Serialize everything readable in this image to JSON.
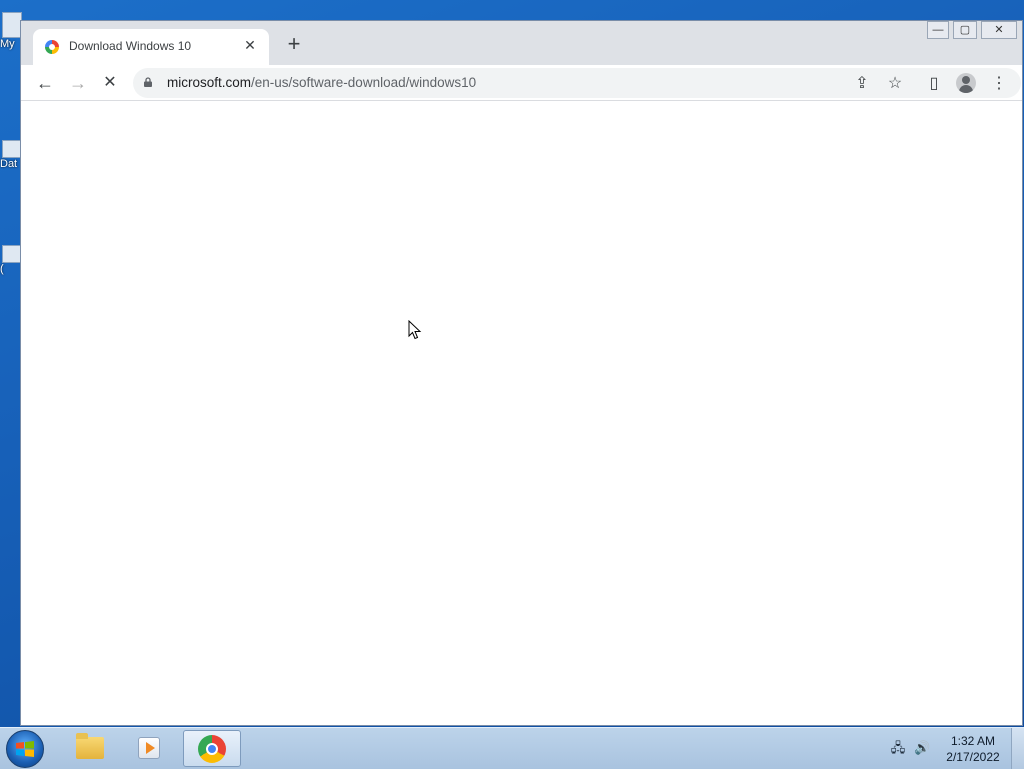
{
  "desktop": {
    "icons": [
      {
        "label": "My"
      },
      {
        "label": "Dat"
      },
      {
        "label": "("
      }
    ]
  },
  "browser": {
    "tab": {
      "title": "Download Windows 10",
      "close": "✕"
    },
    "new_tab": "+",
    "window_controls": {
      "minimize": "—",
      "maximize": "▢",
      "close": "✕"
    },
    "toolbar": {
      "back": "←",
      "forward": "→",
      "stop": "✕"
    },
    "address": {
      "domain": "microsoft.com",
      "path": "/en-us/software-download/windows10"
    },
    "actions": {
      "share": "⇪",
      "bookmark": "☆",
      "side_panel": "▯",
      "menu": "⋮"
    }
  },
  "taskbar": {
    "apps": [
      {
        "name": "Windows Explorer",
        "active": false
      },
      {
        "name": "Windows Media Player",
        "active": false
      },
      {
        "name": "Google Chrome",
        "active": true
      }
    ],
    "tray": {
      "network": "🖧",
      "volume": "🔊"
    },
    "clock": {
      "time": "1:32 AM",
      "date": "2/17/2022"
    }
  }
}
